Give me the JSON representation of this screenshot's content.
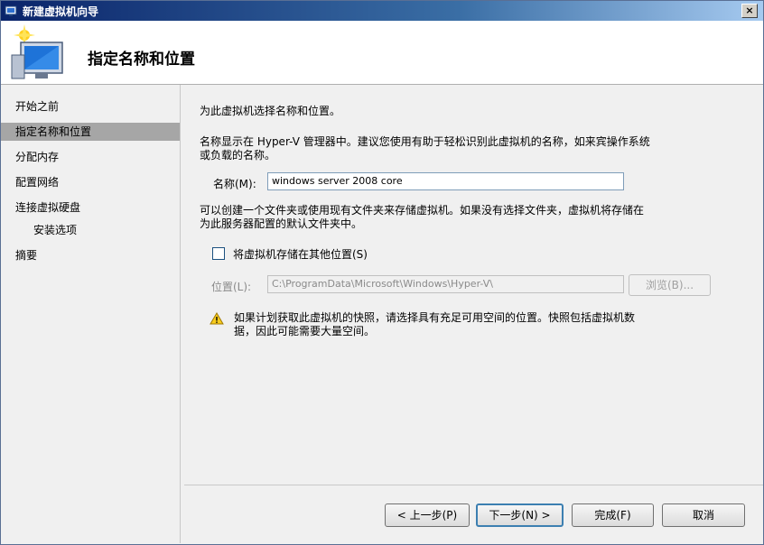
{
  "window": {
    "title": "新建虚拟机向导",
    "close_glyph": "×"
  },
  "header": {
    "title": "指定名称和位置"
  },
  "nav": {
    "items": [
      {
        "label": "开始之前"
      },
      {
        "label": "指定名称和位置"
      },
      {
        "label": "分配内存"
      },
      {
        "label": "配置网络"
      },
      {
        "label": "连接虚拟硬盘"
      },
      {
        "label": "安装选项"
      },
      {
        "label": "摘要"
      }
    ],
    "active_index": 1
  },
  "main": {
    "intro": "为此虚拟机选择名称和位置。",
    "name_desc_line1": "名称显示在 Hyper-V 管理器中。建议您使用有助于轻松识别此虚拟机的名称，如来宾操作系统",
    "name_desc_line2": "或负载的名称。",
    "name_label": "名称(M):",
    "name_value": "windows server 2008 core",
    "folder_desc_line1": "可以创建一个文件夹或使用现有文件夹来存储虚拟机。如果没有选择文件夹，虚拟机将存储在",
    "folder_desc_line2": "为此服务器配置的默认文件夹中。",
    "store_checkbox_label": "将虚拟机存储在其他位置(S)",
    "store_checked": false,
    "location_label": "位置(L):",
    "location_value": "C:\\ProgramData\\Microsoft\\Windows\\Hyper-V\\",
    "browse_label": "浏览(B)...",
    "warning_line1": "如果计划获取此虚拟机的快照，请选择具有充足可用空间的位置。快照包括虚拟机数",
    "warning_line2": "据，因此可能需要大量空间。"
  },
  "footer": {
    "prev_label": "< 上一步(P)",
    "next_label": "下一步(N) >",
    "finish_label": "完成(F)",
    "cancel_label": "取消"
  }
}
